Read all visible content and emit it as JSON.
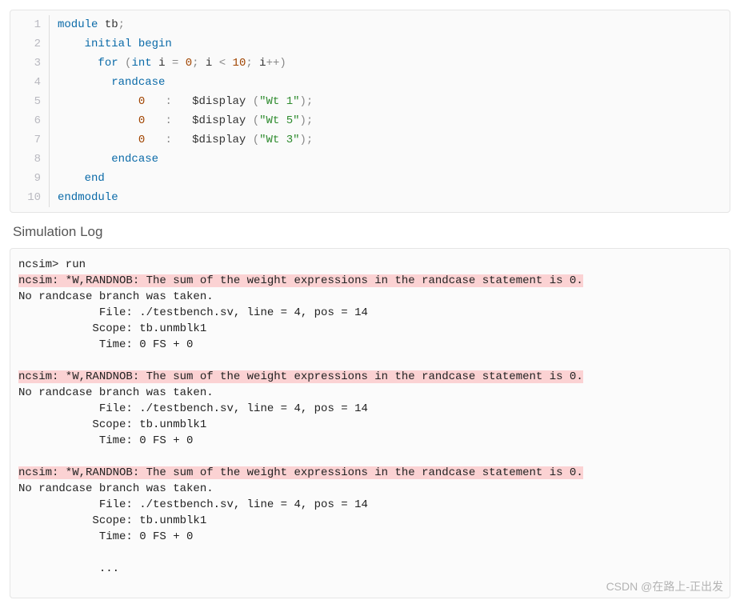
{
  "code": {
    "lines": [
      {
        "n": "1",
        "tokens": [
          [
            "kw",
            "module"
          ],
          [
            "",
            ""
          ],
          [
            "",
            "",
            ""
          ],
          [
            "ident",
            " tb"
          ],
          [
            "punct",
            ";"
          ]
        ]
      },
      {
        "n": "2",
        "tokens": [
          [
            "",
            "    "
          ],
          [
            "kw",
            "initial"
          ],
          [
            "",
            ""
          ],
          [
            "",
            ""
          ],
          [
            "kw",
            " begin"
          ]
        ]
      },
      {
        "n": "3",
        "tokens": [
          [
            "",
            "      "
          ],
          [
            "kw",
            "for"
          ],
          [
            "",
            ""
          ],
          [
            "punct",
            " ("
          ],
          [
            "type",
            "int"
          ],
          [
            "ident",
            " i"
          ],
          [
            "punct",
            " = "
          ],
          [
            "num",
            "0"
          ],
          [
            "punct",
            "; "
          ],
          [
            "ident",
            "i"
          ],
          [
            "punct",
            " < "
          ],
          [
            "num",
            "10"
          ],
          [
            "punct",
            "; "
          ],
          [
            "ident",
            "i"
          ],
          [
            "punct",
            "++"
          ],
          [
            "punct",
            ")"
          ]
        ]
      },
      {
        "n": "4",
        "tokens": [
          [
            "",
            "        "
          ],
          [
            "kw",
            "randcase"
          ]
        ]
      },
      {
        "n": "5",
        "tokens": [
          [
            "",
            "            "
          ],
          [
            "num",
            "0"
          ],
          [
            "",
            "   "
          ],
          [
            "punct",
            ":"
          ],
          [
            "",
            "   "
          ],
          [
            "sys",
            "$display"
          ],
          [
            "punct",
            " ("
          ],
          [
            "str",
            "\"Wt 1\""
          ],
          [
            "punct",
            ");"
          ]
        ]
      },
      {
        "n": "6",
        "tokens": [
          [
            "",
            "            "
          ],
          [
            "num",
            "0"
          ],
          [
            "",
            "   "
          ],
          [
            "punct",
            ":"
          ],
          [
            "",
            "   "
          ],
          [
            "sys",
            "$display"
          ],
          [
            "punct",
            " ("
          ],
          [
            "str",
            "\"Wt 5\""
          ],
          [
            "punct",
            ");"
          ]
        ]
      },
      {
        "n": "7",
        "tokens": [
          [
            "",
            "            "
          ],
          [
            "num",
            "0"
          ],
          [
            "",
            "   "
          ],
          [
            "punct",
            ":"
          ],
          [
            "",
            "   "
          ],
          [
            "sys",
            "$display"
          ],
          [
            "punct",
            " ("
          ],
          [
            "str",
            "\"Wt 3\""
          ],
          [
            "punct",
            ");"
          ]
        ]
      },
      {
        "n": "8",
        "tokens": [
          [
            "",
            "        "
          ],
          [
            "kw",
            "endcase"
          ]
        ]
      },
      {
        "n": "9",
        "tokens": [
          [
            "",
            "    "
          ],
          [
            "kw",
            "end"
          ]
        ]
      },
      {
        "n": "10",
        "tokens": [
          [
            "kw",
            "endmodule"
          ]
        ]
      }
    ]
  },
  "log_title": "Simulation Log",
  "log": {
    "lines": [
      {
        "t": "ncsim> run",
        "hl": false
      },
      {
        "t": "ncsim: *W,RANDNOB: The sum of the weight expressions in the randcase statement is 0.",
        "hl": true
      },
      {
        "t": "No randcase branch was taken.",
        "hl": false
      },
      {
        "t": "            File: ./testbench.sv, line = 4, pos = 14",
        "hl": false
      },
      {
        "t": "           Scope: tb.unmblk1",
        "hl": false
      },
      {
        "t": "            Time: 0 FS + 0",
        "hl": false
      },
      {
        "t": "",
        "hl": false
      },
      {
        "t": "ncsim: *W,RANDNOB: The sum of the weight expressions in the randcase statement is 0.",
        "hl": true
      },
      {
        "t": "No randcase branch was taken.",
        "hl": false
      },
      {
        "t": "            File: ./testbench.sv, line = 4, pos = 14",
        "hl": false
      },
      {
        "t": "           Scope: tb.unmblk1",
        "hl": false
      },
      {
        "t": "            Time: 0 FS + 0",
        "hl": false
      },
      {
        "t": "",
        "hl": false
      },
      {
        "t": "ncsim: *W,RANDNOB: The sum of the weight expressions in the randcase statement is 0.",
        "hl": true
      },
      {
        "t": "No randcase branch was taken.",
        "hl": false
      },
      {
        "t": "            File: ./testbench.sv, line = 4, pos = 14",
        "hl": false
      },
      {
        "t": "           Scope: tb.unmblk1",
        "hl": false
      },
      {
        "t": "            Time: 0 FS + 0",
        "hl": false
      },
      {
        "t": "",
        "hl": false
      },
      {
        "t": "            ...",
        "hl": false
      }
    ]
  },
  "watermark": "CSDN @在路上-正出发"
}
